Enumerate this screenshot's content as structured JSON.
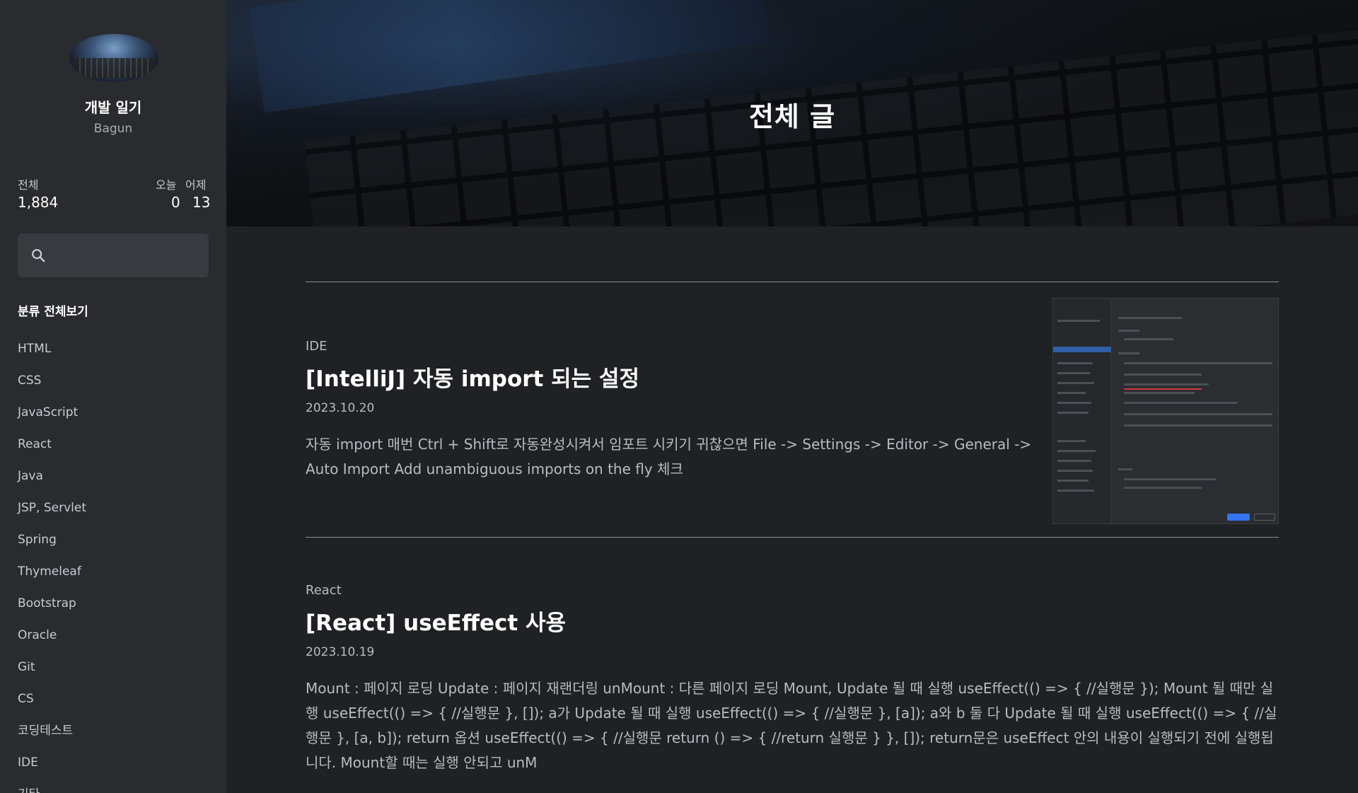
{
  "sidebar": {
    "blog_title": "개발 일기",
    "author": "Bagun",
    "stats": {
      "total_label": "전체",
      "total_value": "1,884",
      "today_label": "오늘",
      "today_value": "0",
      "yesterday_label": "어제",
      "yesterday_value": "13"
    },
    "search": {
      "placeholder": "",
      "icon": "search-icon"
    },
    "category_all": "분류 전체보기",
    "categories": [
      "HTML",
      "CSS",
      "JavaScript",
      "React",
      "Java",
      "JSP, Servlet",
      "Spring",
      "Thymeleaf",
      "Bootstrap",
      "Oracle",
      "Git",
      "CS",
      "코딩테스트",
      "IDE",
      "기타"
    ]
  },
  "hero": {
    "title": "전체 글"
  },
  "posts": [
    {
      "category": "IDE",
      "title": "[IntelliJ] 자동 import 되는 설정",
      "date": "2023.10.20",
      "excerpt": "자동 import 매번 Ctrl + Shift로 자동완성시켜서 임포트 시키기 귀찮으면 File -> Settings -> Editor -> General -> Auto Import Add unambiguous imports on the fly 체크",
      "has_thumbnail": true
    },
    {
      "category": "React",
      "title": "[React] useEffect 사용",
      "date": "2023.10.19",
      "excerpt": "Mount : 페이지 로딩 Update : 페이지 재랜더링 unMount : 다른 페이지 로딩 Mount, Update 될 때 실행 useEffect(() => { //실행문 }); Mount 될 때만 실행 useEffect(() => { //실행문 }, []); a가 Update 될 때 실행 useEffect(() => { //실행문 }, [a]); a와 b 둘 다 Update 될 때 실행 useEffect(() => { //실행문 }, [a, b]); return 옵션 useEffect(() => { //실행문 return () => { //return 실행문 } }, []); return문은 useEffect 안의 내용이 실행되기 전에 실행됩니다. Mount할 때는 실행 안되고 unM",
      "has_thumbnail": false
    }
  ]
}
